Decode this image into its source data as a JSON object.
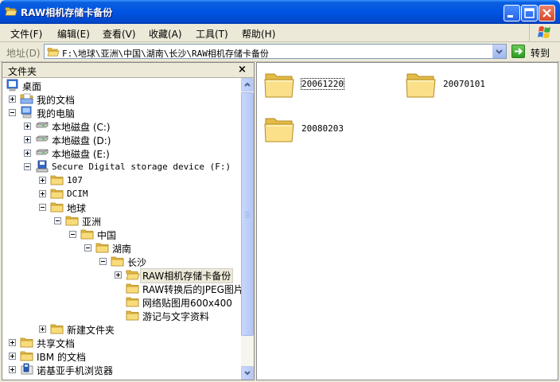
{
  "window": {
    "title": "RAW相机存储卡备份"
  },
  "menu": [
    "文件(F)",
    "编辑(E)",
    "查看(V)",
    "收藏(A)",
    "工具(T)",
    "帮助(H)"
  ],
  "address": {
    "label": "地址(D)",
    "path": "F:\\地球\\亚洲\\中国\\湖南\\长沙\\RAW相机存储卡备份",
    "go_label": "转到"
  },
  "left_pane": {
    "title": "文件夹",
    "close": "×"
  },
  "tree": [
    {
      "label": "桌面",
      "icon": "desktop-icon",
      "expander": "none"
    },
    {
      "label": "我的文档",
      "icon": "my-documents-icon",
      "expander": "plus"
    },
    {
      "label": "我的电脑",
      "icon": "my-computer-icon",
      "expander": "minus"
    },
    {
      "label": "本地磁盘 (C:)",
      "icon": "local-disk-icon",
      "expander": "plus"
    },
    {
      "label": "本地磁盘 (D:)",
      "icon": "local-disk-icon",
      "expander": "plus"
    },
    {
      "label": "本地磁盘 (E:)",
      "icon": "local-disk-icon",
      "expander": "plus"
    },
    {
      "label": "Secure Digital storage device (F:)",
      "icon": "sd-card-icon",
      "expander": "minus"
    },
    {
      "label": "107",
      "icon": "folder-icon",
      "expander": "plus"
    },
    {
      "label": "DCIM",
      "icon": "folder-icon",
      "expander": "plus"
    },
    {
      "label": "地球",
      "icon": "folder-icon",
      "expander": "minus"
    },
    {
      "label": "亚洲",
      "icon": "folder-icon",
      "expander": "minus"
    },
    {
      "label": "中国",
      "icon": "folder-icon",
      "expander": "minus"
    },
    {
      "label": "湖南",
      "icon": "folder-icon",
      "expander": "minus"
    },
    {
      "label": "长沙",
      "icon": "folder-icon",
      "expander": "minus"
    },
    {
      "label": "RAW相机存储卡备份",
      "icon": "folder-open-icon",
      "expander": "plus",
      "selected": true
    },
    {
      "label": "RAW转换后的JPEG图片",
      "icon": "folder-icon",
      "expander": "none"
    },
    {
      "label": "网络贴图用600x400",
      "icon": "folder-icon",
      "expander": "none"
    },
    {
      "label": "游记与文字资料",
      "icon": "folder-icon",
      "expander": "none"
    },
    {
      "label": "新建文件夹",
      "icon": "folder-icon",
      "expander": "plus"
    },
    {
      "label": "共享文档",
      "icon": "folder-icon",
      "expander": "plus"
    },
    {
      "label": "IBM 的文档",
      "icon": "folder-icon",
      "expander": "plus"
    },
    {
      "label": "诺基亚手机浏览器",
      "icon": "phone-browser-icon",
      "expander": "plus"
    }
  ],
  "files": [
    {
      "name": "20061220",
      "icon": "folder-icon",
      "focused": true
    },
    {
      "name": "20070101",
      "icon": "folder-icon",
      "focused": false
    },
    {
      "name": "20080203",
      "icon": "folder-icon",
      "focused": false
    }
  ],
  "colors": {
    "titlebar": "#0054e3",
    "folder": "#f5d66b",
    "selection": "#ece9d8"
  }
}
